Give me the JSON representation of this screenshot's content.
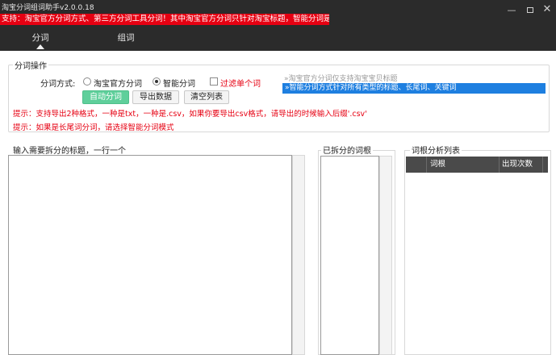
{
  "window": {
    "title": "淘宝分词组词助手v2.0.0.18"
  },
  "banner": {
    "text": "支持：淘宝官方分词方式、第三方分词工具分词！其中淘宝官方分词只针对淘宝标题，智能分词是随意"
  },
  "tabs": [
    {
      "label": "分词",
      "active": true
    },
    {
      "label": "组词",
      "active": false
    }
  ],
  "ops": {
    "legend": "分词操作",
    "mode_label": "分词方式:",
    "radio_official": "淘宝官方分词",
    "radio_smart": "智能分词",
    "selected_mode": "智能分词",
    "checkbox_single": "过滤单个词",
    "checkbox_single_checked": false,
    "btn_auto": "自动分词",
    "btn_export": "导出数据",
    "btn_clear": "清空列表",
    "tip1": "提示：支持导出2种格式，一种是txt，一种是.csv，如果你要导出csv格式，请导出的时候输入后缀'.csv'",
    "tip2": "提示：如果是长尾词分词，请选择智能分词模式",
    "hints": [
      "»淘宝官方分词仅支持淘宝宝贝标题",
      "»智能分词方式针对所有类型的标题、长尾词、关键词"
    ],
    "selected_hint_index": 1
  },
  "input_section": {
    "label": "输入需要拆分的标题，一行一个",
    "value": ""
  },
  "split_section": {
    "label": "已拆分的词根"
  },
  "analysis_section": {
    "label": "词根分析列表",
    "columns": [
      "词根",
      "出现次数"
    ]
  },
  "colors": {
    "banner": "#e60012",
    "accent_button": "#5fcf9b",
    "selected_hint": "#1e7fe0",
    "top_bar": "#2b2b2b"
  }
}
